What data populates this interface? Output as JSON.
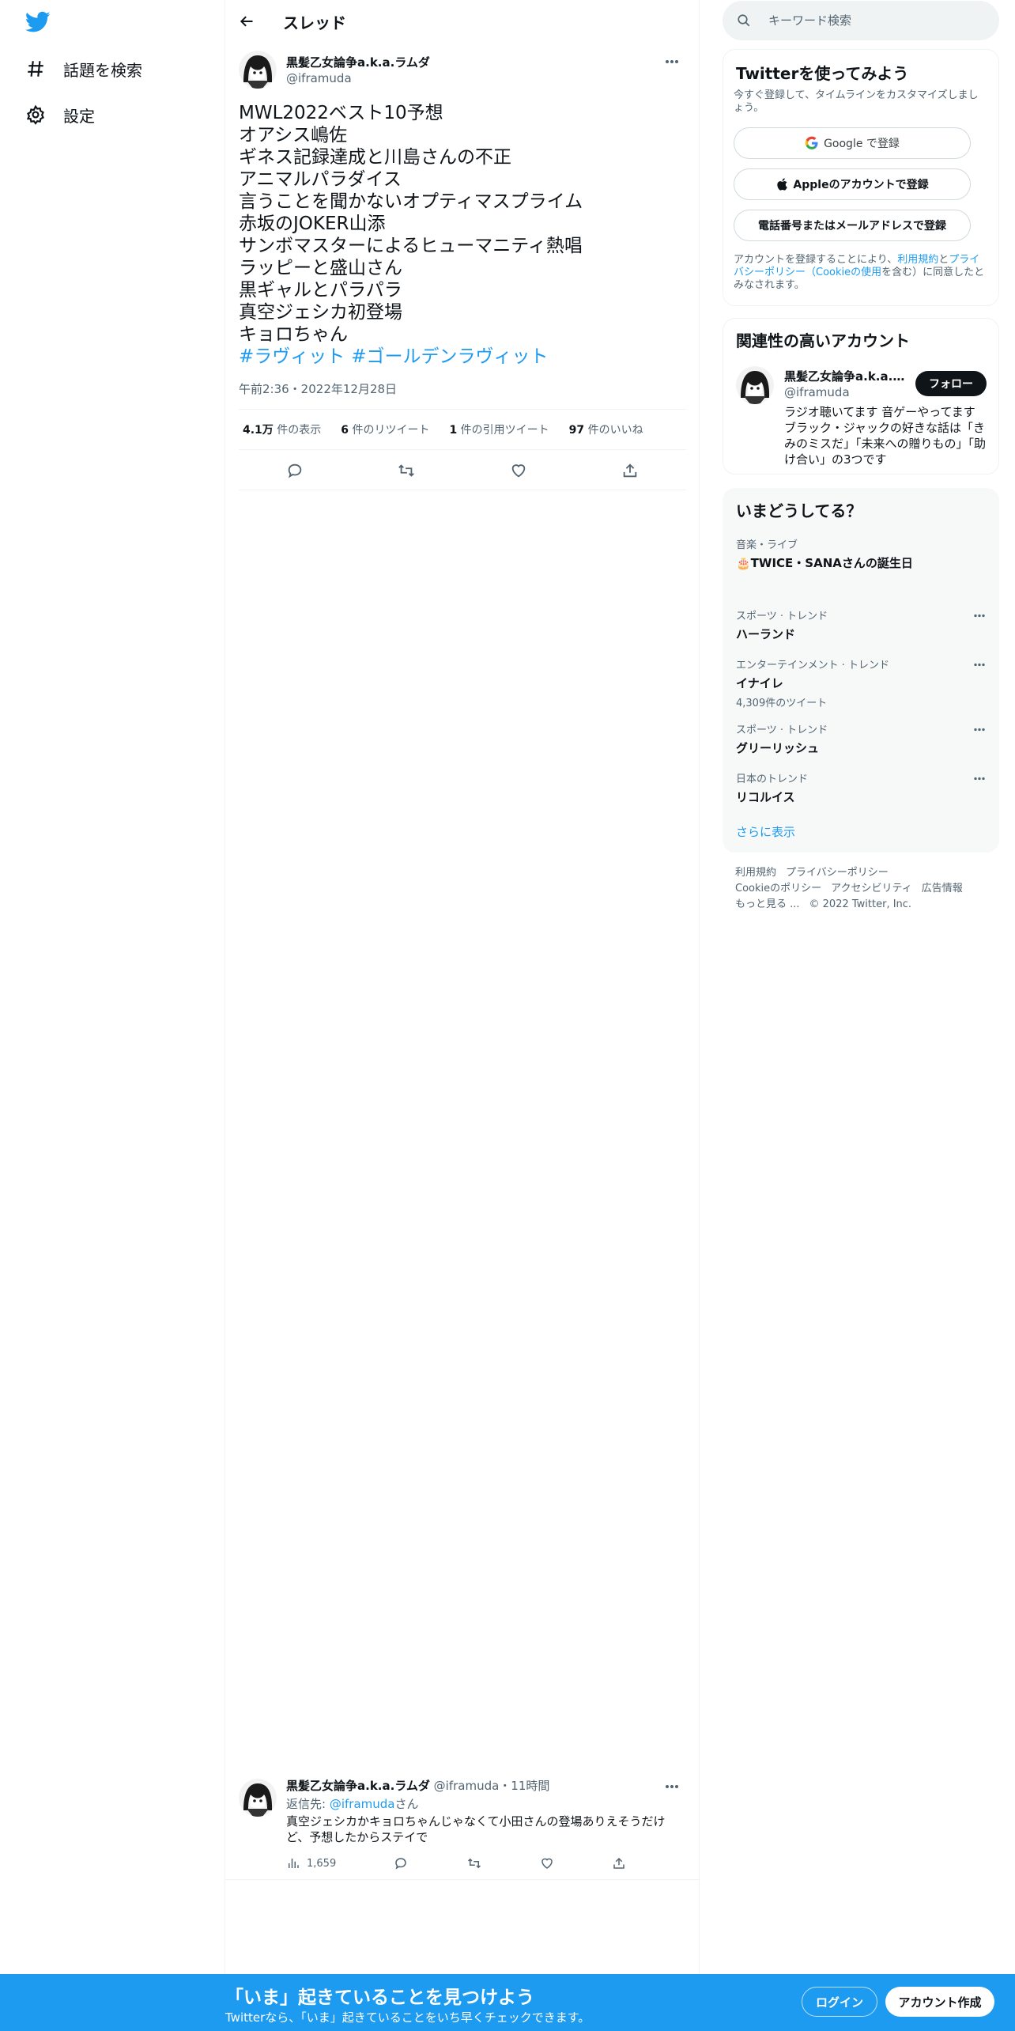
{
  "nav": {
    "items": [
      {
        "label": "話題を検索",
        "icon": "hashtag-icon"
      },
      {
        "label": "設定",
        "icon": "gear-icon"
      }
    ]
  },
  "header": {
    "title": "スレッド"
  },
  "tweet": {
    "author_name": "黒髪乙女論争a.k.a.ラムダ",
    "author_handle": "@iframuda",
    "lines": [
      "MWL2022ベスト10予想",
      "オアシス嶋佐",
      "ギネス記録達成と川島さんの不正",
      "アニマルパラダイス",
      "言うことを聞かないオプティマスプライム",
      "赤坂のJOKER山添",
      "サンボマスターによるヒューマニティ熱唱",
      "ラッピーと盛山さん",
      "黒ギャルとパラパラ",
      "真空ジェシカ初登場",
      "キョロちゃん"
    ],
    "hashtags": [
      "#ラヴィット",
      "#ゴールデンラヴィット"
    ],
    "timestamp": "午前2:36・2022年12月28日",
    "stats": {
      "views_num": "4.1万",
      "views_label": "件の表示",
      "retweets_num": "6",
      "retweets_label": "件のリツイート",
      "quotes_num": "1",
      "quotes_label": "件の引用ツイート",
      "likes_num": "97",
      "likes_label": "件のいいね"
    }
  },
  "reply": {
    "author_name": "黒髪乙女論争a.k.a.ラムダ",
    "meta": "@iframuda・11時間",
    "reply_to_prefix": "返信先: ",
    "reply_to_handle": "@iframuda",
    "reply_to_suffix": "さん",
    "text": "真空ジェシカかキョロちゃんじゃなくて小田さんの登場ありえそうだけど、予想したからステイで",
    "views": "1,659"
  },
  "search": {
    "placeholder": "キーワード検索"
  },
  "signup": {
    "title": "Twitterを使ってみよう",
    "subtitle": "今すぐ登録して、タイムラインをカスタマイズしましょう。",
    "google_label": "Google で登録",
    "apple_label": "Appleのアカウントで登録",
    "phone_label": "電話番号またはメールアドレスで登録",
    "legal_prefix": "アカウントを登録することにより、",
    "legal_terms": "利用規約",
    "legal_and": "と",
    "legal_privacy": "プライバシーポリシー",
    "legal_cookie": "（Cookieの使用",
    "legal_suffix": "を含む）に同意したとみなされます。"
  },
  "related": {
    "title": "関連性の高いアカウント",
    "name": "黒髪乙女論争a.k.a.ラムダ",
    "handle": "@iframuda",
    "follow_label": "フォロー",
    "bio": "ラジオ聴いてます 音ゲーやってます ブラック・ジャックの好きな話は「きみのミスだ」「未来への贈りもの」「助け合い」の3つです"
  },
  "trends": {
    "title": "いまどうしてる？",
    "items": [
      {
        "category": "音楽・ライブ",
        "name": "🎂TWICE・SANAさんの誕生日",
        "count": ""
      },
      {
        "category": "スポーツ · トレンド",
        "name": "ハーランド",
        "count": ""
      },
      {
        "category": "エンターテインメント · トレンド",
        "name": "イナイレ",
        "count": "4,309件のツイート"
      },
      {
        "category": "スポーツ · トレンド",
        "name": "グリーリッシュ",
        "count": ""
      },
      {
        "category": "日本のトレンド",
        "name": "リコルイス",
        "count": ""
      }
    ],
    "show_more": "さらに表示"
  },
  "footer": {
    "links": [
      "利用規約",
      "プライバシーポリシー",
      "Cookieのポリシー",
      "アクセシビリティ",
      "広告情報",
      "もっと見る ..."
    ],
    "copyright": "© 2022 Twitter, Inc."
  },
  "banner": {
    "title": "「いま」起きていることを見つけよう",
    "subtitle": "Twitterなら、「いま」起きていることをいち早くチェックできます。",
    "login": "ログイン",
    "signup": "アカウント作成"
  },
  "colors": {
    "accent": "#1d9bf0",
    "text": "#0f1419",
    "muted": "#536471",
    "border": "#eff3f4"
  }
}
